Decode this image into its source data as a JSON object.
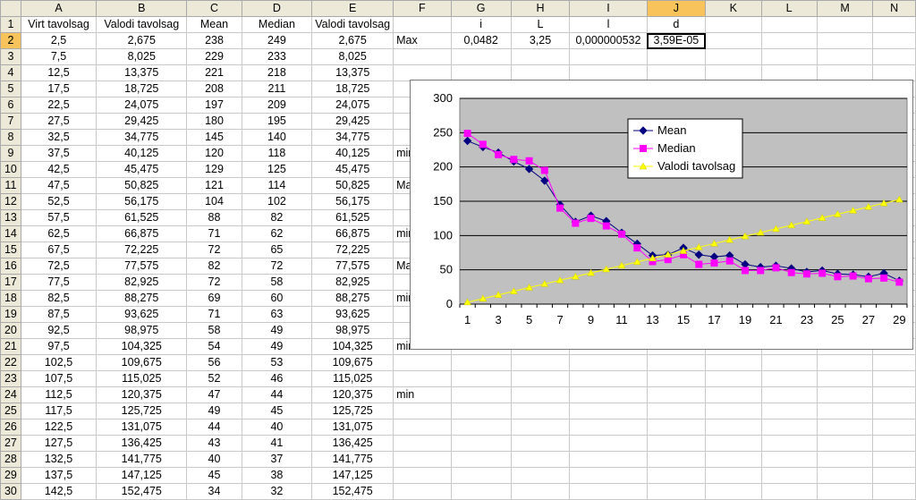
{
  "sheet": {
    "col_headers": [
      "A",
      "B",
      "C",
      "D",
      "E",
      "F",
      "G",
      "H",
      "I",
      "J",
      "K",
      "L",
      "M",
      "N"
    ],
    "selected_col": "J",
    "selected_row": 2,
    "row_numbers": [
      1,
      2,
      3,
      4,
      5,
      6,
      7,
      8,
      9,
      10,
      11,
      12,
      13,
      14,
      15,
      16,
      17,
      18,
      19,
      20,
      21,
      22,
      23,
      24,
      25,
      26,
      27,
      28,
      29,
      30
    ],
    "rows": [
      [
        "Virt tavolsag",
        "Valodi tavolsag",
        "Mean",
        "Median",
        "Valodi tavolsag",
        "",
        "i",
        "L",
        "l",
        "d",
        "",
        "",
        "",
        ""
      ],
      [
        "2,5",
        "2,675",
        "238",
        "249",
        "2,675",
        "Max",
        "0,0482",
        "3,25",
        "0,000000532",
        "3,59E-05",
        "",
        "",
        "",
        ""
      ],
      [
        "7,5",
        "8,025",
        "229",
        "233",
        "8,025",
        "",
        "",
        "",
        "",
        "",
        "",
        "",
        "",
        ""
      ],
      [
        "12,5",
        "13,375",
        "221",
        "218",
        "13,375",
        "",
        "",
        "",
        "",
        "",
        "",
        "",
        "",
        ""
      ],
      [
        "17,5",
        "18,725",
        "208",
        "211",
        "18,725",
        "",
        "",
        "",
        "",
        "",
        "",
        "",
        "",
        ""
      ],
      [
        "22,5",
        "24,075",
        "197",
        "209",
        "24,075",
        "",
        "",
        "",
        "",
        "",
        "",
        "",
        "",
        ""
      ],
      [
        "27,5",
        "29,425",
        "180",
        "195",
        "29,425",
        "",
        "",
        "",
        "",
        "",
        "",
        "",
        "",
        ""
      ],
      [
        "32,5",
        "34,775",
        "145",
        "140",
        "34,775",
        "",
        "",
        "",
        "",
        "",
        "",
        "",
        "",
        ""
      ],
      [
        "37,5",
        "40,125",
        "120",
        "118",
        "40,125",
        "min",
        "",
        "",
        "",
        "",
        "",
        "",
        "",
        ""
      ],
      [
        "42,5",
        "45,475",
        "129",
        "125",
        "45,475",
        "",
        "",
        "",
        "",
        "",
        "",
        "",
        "",
        ""
      ],
      [
        "47,5",
        "50,825",
        "121",
        "114",
        "50,825",
        "Max",
        "",
        "",
        "",
        "",
        "",
        "",
        "",
        ""
      ],
      [
        "52,5",
        "56,175",
        "104",
        "102",
        "56,175",
        "",
        "",
        "",
        "",
        "",
        "",
        "",
        "",
        ""
      ],
      [
        "57,5",
        "61,525",
        "88",
        "82",
        "61,525",
        "",
        "",
        "",
        "",
        "",
        "",
        "",
        "",
        ""
      ],
      [
        "62,5",
        "66,875",
        "71",
        "62",
        "66,875",
        "min",
        "",
        "",
        "",
        "",
        "",
        "",
        "",
        ""
      ],
      [
        "67,5",
        "72,225",
        "72",
        "65",
        "72,225",
        "",
        "",
        "",
        "",
        "",
        "",
        "",
        "",
        ""
      ],
      [
        "72,5",
        "77,575",
        "82",
        "72",
        "77,575",
        "Max",
        "",
        "",
        "",
        "",
        "",
        "",
        "",
        ""
      ],
      [
        "77,5",
        "82,925",
        "72",
        "58",
        "82,925",
        "",
        "",
        "",
        "",
        "",
        "",
        "",
        "",
        ""
      ],
      [
        "82,5",
        "88,275",
        "69",
        "60",
        "88,275",
        "min",
        "",
        "",
        "",
        "",
        "",
        "",
        "",
        ""
      ],
      [
        "87,5",
        "93,625",
        "71",
        "63",
        "93,625",
        "",
        "",
        "",
        "",
        "",
        "",
        "",
        "",
        ""
      ],
      [
        "92,5",
        "98,975",
        "58",
        "49",
        "98,975",
        "",
        "",
        "",
        "",
        "",
        "",
        "",
        "",
        ""
      ],
      [
        "97,5",
        "104,325",
        "54",
        "49",
        "104,325",
        "min",
        "",
        "",
        "",
        "",
        "",
        "",
        "",
        ""
      ],
      [
        "102,5",
        "109,675",
        "56",
        "53",
        "109,675",
        "",
        "",
        "",
        "",
        "",
        "",
        "",
        "",
        ""
      ],
      [
        "107,5",
        "115,025",
        "52",
        "46",
        "115,025",
        "",
        "",
        "",
        "",
        "",
        "",
        "",
        "",
        ""
      ],
      [
        "112,5",
        "120,375",
        "47",
        "44",
        "120,375",
        "min",
        "",
        "",
        "",
        "",
        "",
        "",
        "",
        ""
      ],
      [
        "117,5",
        "125,725",
        "49",
        "45",
        "125,725",
        "",
        "",
        "",
        "",
        "",
        "",
        "",
        "",
        ""
      ],
      [
        "122,5",
        "131,075",
        "44",
        "40",
        "131,075",
        "",
        "",
        "",
        "",
        "",
        "",
        "",
        "",
        ""
      ],
      [
        "127,5",
        "136,425",
        "43",
        "41",
        "136,425",
        "",
        "",
        "",
        "",
        "",
        "",
        "",
        "",
        ""
      ],
      [
        "132,5",
        "141,775",
        "40",
        "37",
        "141,775",
        "",
        "",
        "",
        "",
        "",
        "",
        "",
        "",
        ""
      ],
      [
        "137,5",
        "147,125",
        "45",
        "38",
        "147,125",
        "",
        "",
        "",
        "",
        "",
        "",
        "",
        "",
        ""
      ],
      [
        "142,5",
        "152,475",
        "34",
        "32",
        "152,475",
        "",
        "",
        "",
        "",
        "",
        "",
        "",
        "",
        ""
      ]
    ]
  },
  "chart_data": {
    "type": "line",
    "x": [
      1,
      2,
      3,
      4,
      5,
      6,
      7,
      8,
      9,
      10,
      11,
      12,
      13,
      14,
      15,
      16,
      17,
      18,
      19,
      20,
      21,
      22,
      23,
      24,
      25,
      26,
      27,
      28,
      29
    ],
    "x_tick_labels": [
      "1",
      "3",
      "5",
      "7",
      "9",
      "11",
      "13",
      "15",
      "17",
      "19",
      "21",
      "23",
      "25",
      "27",
      "29"
    ],
    "y_tick_labels": [
      "0",
      "50",
      "100",
      "150",
      "200",
      "250",
      "300"
    ],
    "ylim": [
      0,
      300
    ],
    "grid": true,
    "legend_position": "top-center",
    "series": [
      {
        "name": "Mean",
        "color": "#000080",
        "marker": "diamond",
        "values": [
          238,
          229,
          221,
          208,
          197,
          180,
          145,
          120,
          129,
          121,
          104,
          88,
          71,
          72,
          82,
          72,
          69,
          71,
          58,
          54,
          56,
          52,
          47,
          49,
          44,
          43,
          40,
          45,
          34
        ]
      },
      {
        "name": "Median",
        "color": "#ff00ff",
        "marker": "square",
        "values": [
          249,
          233,
          218,
          211,
          209,
          195,
          140,
          118,
          125,
          114,
          102,
          82,
          62,
          65,
          72,
          58,
          60,
          63,
          49,
          49,
          53,
          46,
          44,
          45,
          40,
          41,
          37,
          38,
          32
        ]
      },
      {
        "name": "Valodi tavolsag",
        "color": "#ffff00",
        "marker": "triangle",
        "values": [
          2.675,
          8.025,
          13.375,
          18.725,
          24.075,
          29.425,
          34.775,
          40.125,
          45.475,
          50.825,
          56.175,
          61.525,
          66.875,
          72.225,
          77.575,
          82.925,
          88.275,
          93.625,
          98.975,
          104.325,
          109.675,
          115.025,
          120.375,
          125.725,
          131.075,
          136.425,
          141.775,
          147.125,
          152.475
        ]
      }
    ]
  }
}
